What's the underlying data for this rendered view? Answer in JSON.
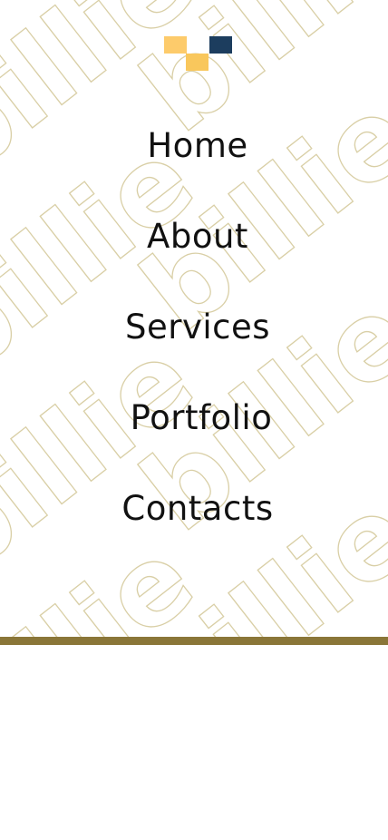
{
  "brand": {
    "logo_colors": [
      "#FDCB6B",
      "#F9C75C",
      "#1C3D5E"
    ],
    "logo_icon": "brand-logo-icon"
  },
  "theme": {
    "accent": "#8A7638",
    "watermark_color": "#D9CFA6",
    "background": "#FFFFFF",
    "text": "#111111"
  },
  "watermark": {
    "text": "billie"
  },
  "nav": {
    "items": [
      {
        "label": "Home"
      },
      {
        "label": "About"
      },
      {
        "label": "Services"
      },
      {
        "label": "Portfolio"
      },
      {
        "label": "Contacts"
      }
    ]
  }
}
